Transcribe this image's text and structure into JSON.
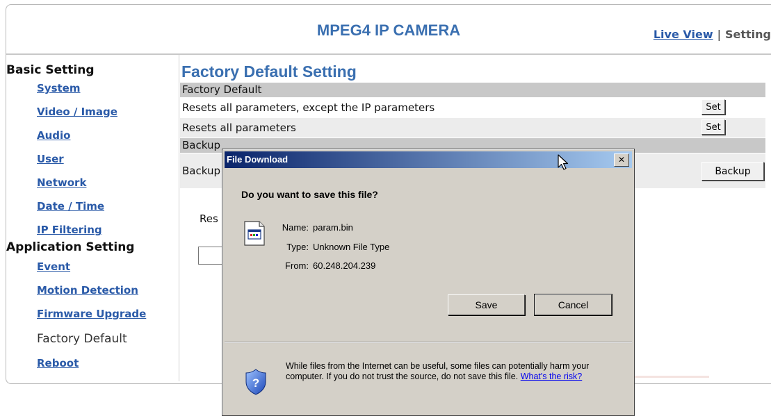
{
  "header": {
    "title": "MPEG4 IP CAMERA",
    "live_view": "Live View",
    "separator": "|",
    "setting": "Setting"
  },
  "sidebar": {
    "basic_heading": "Basic Setting",
    "basic_items": [
      "System",
      "Video / Image",
      "Audio",
      "User",
      "Network",
      "Date / Time",
      "IP Filtering"
    ],
    "application_heading": "Application Setting",
    "application_items": [
      "Event",
      "Motion Detection",
      "Firmware Upgrade"
    ],
    "current": "Factory Default",
    "reboot": "Reboot"
  },
  "main": {
    "title": "Factory Default Setting",
    "factory_section": "Factory Default",
    "row1_text": "Resets all parameters, except the IP parameters",
    "row1_button": "Set",
    "row2_text": "Resets all parameters",
    "row2_button": "Set",
    "backup_section": "Backup",
    "backup_row_text": "Backup",
    "backup_button": "Backup",
    "restore_label": "Res"
  },
  "dialog": {
    "title": "File Download",
    "close": "✕",
    "question": "Do you want to save this file?",
    "name_label": "Name:",
    "name_value": "param.bin",
    "type_label": "Type:",
    "type_value": "Unknown File Type",
    "from_label": "From:",
    "from_value": "60.248.204.239",
    "save_button": "Save",
    "cancel_button": "Cancel",
    "warning_text": "While files from the Internet can be useful, some files can potentially harm your computer. If you do not trust the source, do not save this file.",
    "risk_link": "What's the risk?"
  }
}
